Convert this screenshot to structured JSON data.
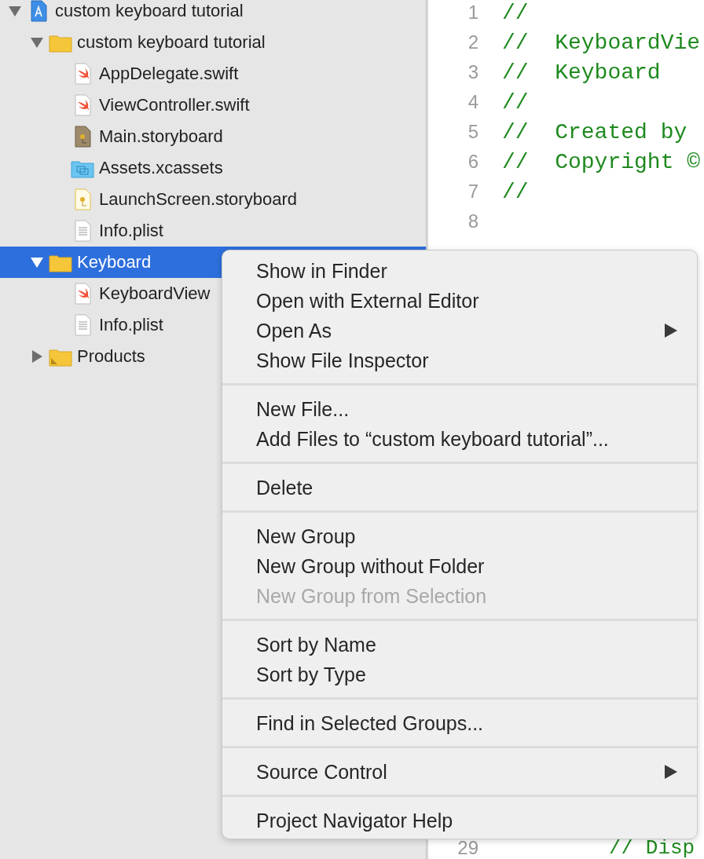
{
  "navigator": {
    "items": [
      {
        "label": "custom keyboard tutorial",
        "kind": "project",
        "expanded": true,
        "selected": false,
        "children": [
          {
            "label": "custom keyboard tutorial",
            "kind": "folder",
            "expanded": true,
            "selected": false,
            "children": [
              {
                "label": "AppDelegate.swift",
                "kind": "swift",
                "selected": false
              },
              {
                "label": "ViewController.swift",
                "kind": "swift",
                "selected": false
              },
              {
                "label": "Main.storyboard",
                "kind": "storyboard",
                "selected": false
              },
              {
                "label": "Assets.xcassets",
                "kind": "assets",
                "selected": false
              },
              {
                "label": "LaunchScreen.storyboard",
                "kind": "launch",
                "selected": false
              },
              {
                "label": "Info.plist",
                "kind": "plist",
                "selected": false
              }
            ]
          },
          {
            "label": "Keyboard",
            "kind": "folder",
            "expanded": true,
            "selected": true,
            "children": [
              {
                "label": "KeyboardView",
                "kind": "swift",
                "selected": false
              },
              {
                "label": "Info.plist",
                "kind": "plist",
                "selected": false
              }
            ]
          },
          {
            "label": "Products",
            "kind": "products",
            "expanded": false,
            "selected": false
          }
        ]
      }
    ]
  },
  "editor": {
    "lines": [
      {
        "number": "1",
        "kind": "comment",
        "text": "//"
      },
      {
        "number": "2",
        "kind": "comment",
        "text": "//  KeyboardVie"
      },
      {
        "number": "3",
        "kind": "comment",
        "text": "//  Keyboard"
      },
      {
        "number": "4",
        "kind": "comment",
        "text": "//"
      },
      {
        "number": "5",
        "kind": "comment",
        "text": "//  Created by"
      },
      {
        "number": "6",
        "kind": "comment",
        "text": "//  Copyright ©"
      },
      {
        "number": "7",
        "kind": "comment",
        "text": "//"
      },
      {
        "number": "8",
        "kind": "blank"
      }
    ],
    "bottom_line": {
      "number": "29",
      "kind": "comment",
      "text": "// Disp"
    }
  },
  "context_menu": {
    "groups": [
      {
        "items": [
          {
            "label": "Show in Finder",
            "disabled": false,
            "submenu": false
          },
          {
            "label": "Open with External Editor",
            "disabled": false,
            "submenu": false
          },
          {
            "label": "Open As",
            "disabled": false,
            "submenu": true
          },
          {
            "label": "Show File Inspector",
            "disabled": false,
            "submenu": false
          }
        ]
      },
      {
        "items": [
          {
            "label": "New File...",
            "disabled": false,
            "submenu": false
          },
          {
            "label": "Add Files to “custom keyboard tutorial”...",
            "disabled": false,
            "submenu": false
          }
        ]
      },
      {
        "items": [
          {
            "label": "Delete",
            "disabled": false,
            "submenu": false
          }
        ]
      },
      {
        "items": [
          {
            "label": "New Group",
            "disabled": false,
            "submenu": false
          },
          {
            "label": "New Group without Folder",
            "disabled": false,
            "submenu": false
          },
          {
            "label": "New Group from Selection",
            "disabled": true,
            "submenu": false
          }
        ]
      },
      {
        "items": [
          {
            "label": "Sort by Name",
            "disabled": false,
            "submenu": false
          },
          {
            "label": "Sort by Type",
            "disabled": false,
            "submenu": false
          }
        ]
      },
      {
        "items": [
          {
            "label": "Find in Selected Groups...",
            "disabled": false,
            "submenu": false
          }
        ]
      },
      {
        "items": [
          {
            "label": "Source Control",
            "disabled": false,
            "submenu": true
          }
        ]
      },
      {
        "items": [
          {
            "label": "Project Navigator Help",
            "disabled": false,
            "submenu": false
          }
        ]
      }
    ]
  }
}
